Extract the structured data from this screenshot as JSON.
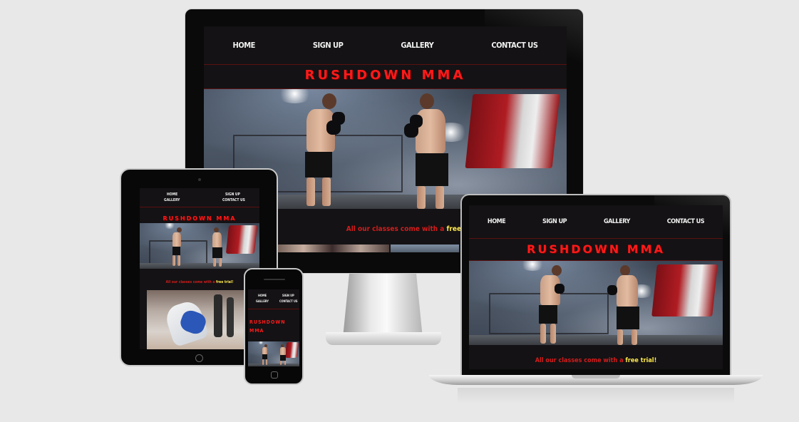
{
  "site": {
    "nav": [
      "HOME",
      "SIGN UP",
      "GALLERY",
      "CONTACT US"
    ],
    "brand": "RUSHDOWN MMA",
    "brand_mobile_line1": "RUSHDOWN",
    "brand_mobile_line2": "MMA",
    "tagline_prefix": "All our classes come with a ",
    "tagline_highlight": "free trial!"
  },
  "colors": {
    "page_bg": "#e8e8e8",
    "site_bg": "#141214",
    "brand_red": "#ff1a1a",
    "tagline_red": "#d41c1c",
    "highlight_yellow": "#ffe94d",
    "nav_text": "#f2f2f2"
  },
  "devices": [
    "desktop-monitor",
    "laptop",
    "tablet",
    "phone"
  ]
}
